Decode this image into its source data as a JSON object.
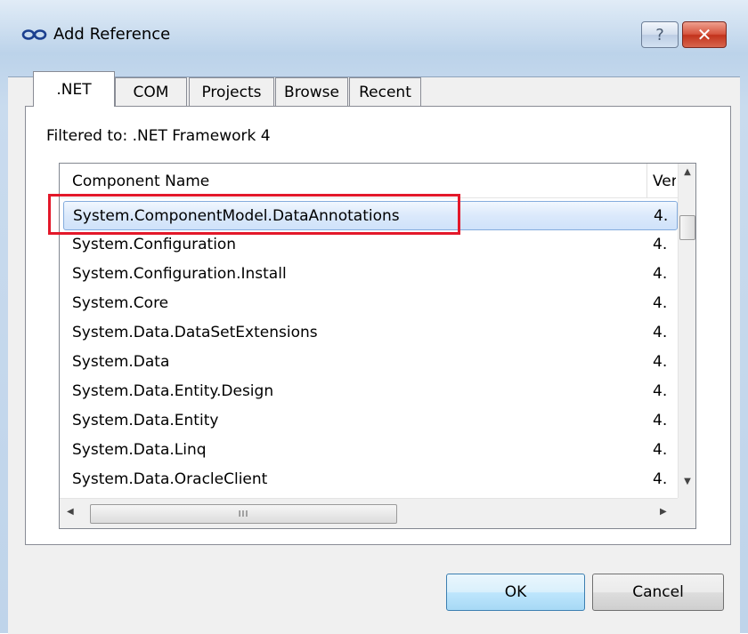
{
  "window": {
    "title": "Add Reference",
    "help_label": "?",
    "close_label": "✕"
  },
  "tabs": [
    {
      "label": ".NET",
      "active": true
    },
    {
      "label": "COM",
      "active": false
    },
    {
      "label": "Projects",
      "active": false
    },
    {
      "label": "Browse",
      "active": false
    },
    {
      "label": "Recent",
      "active": false
    }
  ],
  "filter_text": "Filtered to: .NET Framework 4",
  "list": {
    "columns": {
      "name": "Component Name",
      "version": "Version"
    },
    "rows": [
      {
        "name": "System.ComponentModel.DataAnnotations",
        "version": "4.",
        "selected": true
      },
      {
        "name": "System.Configuration",
        "version": "4."
      },
      {
        "name": "System.Configuration.Install",
        "version": "4."
      },
      {
        "name": "System.Core",
        "version": "4."
      },
      {
        "name": "System.Data.DataSetExtensions",
        "version": "4."
      },
      {
        "name": "System.Data",
        "version": "4."
      },
      {
        "name": "System.Data.Entity.Design",
        "version": "4."
      },
      {
        "name": "System.Data.Entity",
        "version": "4."
      },
      {
        "name": "System.Data.Linq",
        "version": "4."
      },
      {
        "name": "System.Data.OracleClient",
        "version": "4."
      }
    ],
    "hscroll_grip": "III"
  },
  "buttons": {
    "ok": "OK",
    "cancel": "Cancel"
  },
  "colors": {
    "highlight": "#e3182a",
    "selection": "#cfe2fa",
    "close": "#c2331c"
  }
}
